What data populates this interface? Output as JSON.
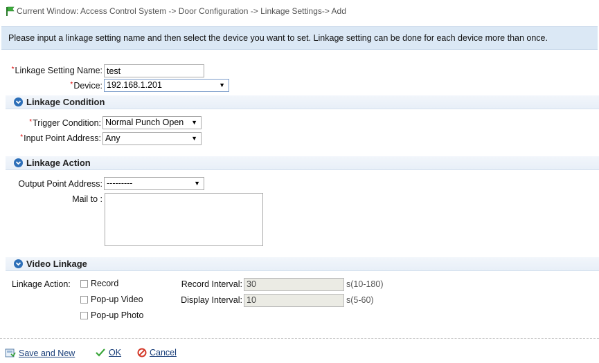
{
  "breadcrumb": {
    "text": "Current Window: Access Control System -> Door Configuration -> Linkage Settings-> Add"
  },
  "notice": "Please input a linkage setting name and then select the device you want to set. Linkage setting can be done for each device more than once.",
  "form": {
    "required_mark": "*",
    "linkage_name_label": "Linkage Setting Name:",
    "linkage_name_value": "test",
    "device_label": "Device:",
    "device_value": "192.168.1.201"
  },
  "linkage_condition": {
    "title": "Linkage Condition",
    "trigger_label": "Trigger Condition:",
    "trigger_value": "Normal Punch Open",
    "input_point_label": "Input Point Address:",
    "input_point_value": "Any"
  },
  "linkage_action": {
    "title": "Linkage Action",
    "output_point_label": "Output Point Address:",
    "output_point_value": "---------",
    "mail_label": "Mail to :",
    "mail_value": ""
  },
  "video_linkage": {
    "title": "Video Linkage",
    "action_label": "Linkage Action:",
    "options": [
      "Record",
      "Pop-up Video",
      "Pop-up Photo"
    ],
    "record_interval_label": "Record Interval:",
    "record_interval_value": "30",
    "record_interval_hint": "s(10-180)",
    "display_interval_label": "Display Interval:",
    "display_interval_value": "10",
    "display_interval_hint": "s(5-60)"
  },
  "footer": {
    "save_new": "Save and New",
    "ok": "OK",
    "cancel": "Cancel"
  },
  "icons": {
    "flag": "flag-icon",
    "chevron": "chevron-down-icon",
    "save": "save-icon",
    "ok": "check-icon",
    "cancel": "cancel-icon"
  },
  "colors": {
    "notice_bg": "#dbe8f5",
    "section_icon": "#2d6fb8",
    "required": "#dd0000",
    "link": "#1a3f7a"
  }
}
